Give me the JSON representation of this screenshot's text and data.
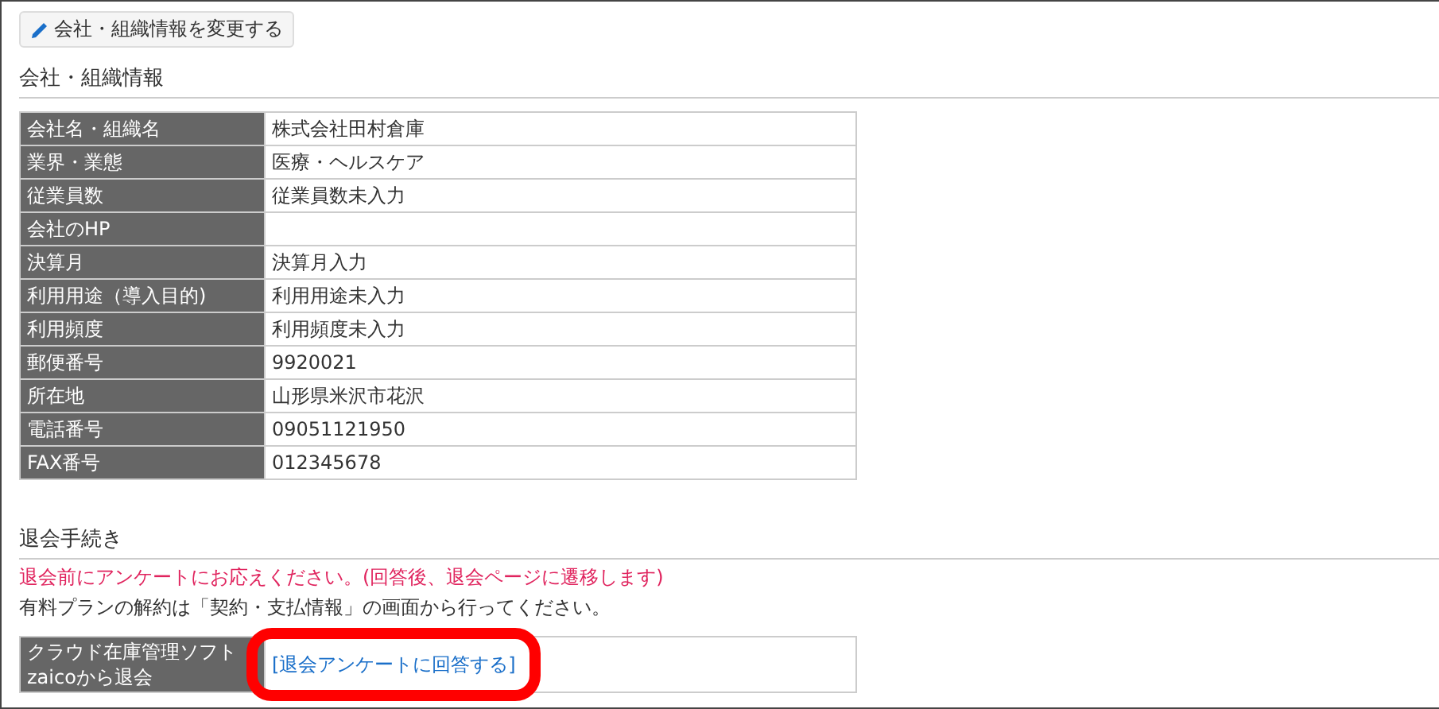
{
  "edit_button": {
    "label": "会社・組織情報を変更する"
  },
  "company_section": {
    "title": "会社・組織情報",
    "rows": [
      {
        "label": "会社名・組織名",
        "value": "株式会社田村倉庫"
      },
      {
        "label": "業界・業態",
        "value": "医療・ヘルスケア"
      },
      {
        "label": "従業員数",
        "value": "従業員数未入力"
      },
      {
        "label": "会社のHP"
      },
      {
        "label": "決算月",
        "value": "決算月入力"
      },
      {
        "label": "利用用途（導入目的)",
        "value": "利用用途未入力"
      },
      {
        "label": "利用頻度",
        "value": "利用頻度未入力"
      },
      {
        "label": "郵便番号",
        "value": "9920021"
      },
      {
        "label": "所在地",
        "value": "山形県米沢市花沢"
      },
      {
        "label": "電話番号",
        "value": "09051121950"
      },
      {
        "label": "FAX番号",
        "value": "012345678"
      }
    ]
  },
  "withdrawal_section": {
    "title": "退会手続き",
    "notice": "退会前にアンケートにお応えください。(回答後、退会ページに遷移します)",
    "note": "有料プランの解約は「契約・支払情報」の画面から行ってください。",
    "row": {
      "label": "クラウド在庫管理ソフトzaicoから退会",
      "link": "[退会アンケートに回答する]",
      "highlighted": true
    }
  }
}
